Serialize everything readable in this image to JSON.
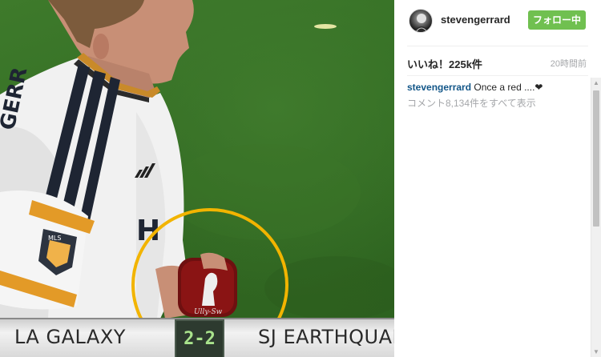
{
  "post": {
    "username": "stevengerrard",
    "follow_label": "フォロー中",
    "likes": "いいね！225k件",
    "time_ago": "20時間前",
    "caption_user": "stevengerrard",
    "caption_text": "Once a red ....❤",
    "all_comments": "コメント8,134件をすべて表示"
  },
  "photo": {
    "home_team": "LA GALAXY",
    "away_team": "SJ EARTHQUAKE",
    "score": "2-2",
    "highlight_color": "#f2b400"
  },
  "colors": {
    "follow": "#70c050",
    "username": "#262626",
    "caption_user": "#125688",
    "muted": "#a5a7aa"
  }
}
